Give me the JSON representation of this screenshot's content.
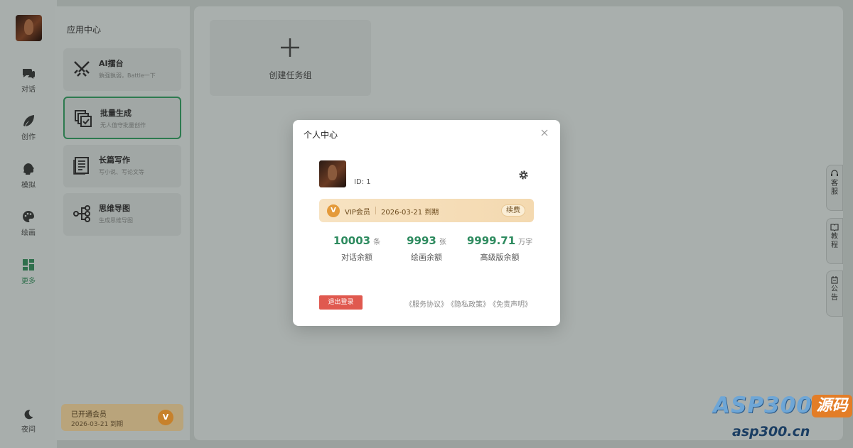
{
  "nav": {
    "items": [
      {
        "label": "对话",
        "icon": "chat-icon"
      },
      {
        "label": "创作",
        "icon": "feather-icon"
      },
      {
        "label": "模拟",
        "icon": "head-icon"
      },
      {
        "label": "绘画",
        "icon": "palette-icon"
      },
      {
        "label": "更多",
        "icon": "grid-icon"
      }
    ],
    "night_label": "夜间"
  },
  "panel": {
    "title": "应用中心",
    "apps": [
      {
        "title": "AI擂台",
        "subtitle": "孰强孰弱，Battle一下",
        "icon": "swords-icon"
      },
      {
        "title": "批量生成",
        "subtitle": "无人值守批量创作",
        "icon": "batch-icon"
      },
      {
        "title": "长篇写作",
        "subtitle": "写小说、写论文等",
        "icon": "document-icon"
      },
      {
        "title": "思维导图",
        "subtitle": "生成思维导图",
        "icon": "mindmap-icon"
      }
    ],
    "member": {
      "status": "已开通会员",
      "expiry": "2026-03-21 到期",
      "badge": "V"
    }
  },
  "main": {
    "create_label": "创建任务组"
  },
  "side_tabs": [
    {
      "label": "客服",
      "icon": "headset-icon"
    },
    {
      "label": "教程",
      "icon": "book-icon"
    },
    {
      "label": "公告",
      "icon": "notice-icon"
    }
  ],
  "modal": {
    "title": "个人中心",
    "user_id": "ID: 1",
    "vip": {
      "badge": "V",
      "label": "VIP会员",
      "expiry": "2026-03-21 到期",
      "renew": "续费"
    },
    "stats": [
      {
        "value": "10003",
        "unit": "条",
        "caption": "对话余额"
      },
      {
        "value": "9993",
        "unit": "张",
        "caption": "绘画余额"
      },
      {
        "value": "9999.71",
        "unit": "万字",
        "caption": "高级版余额"
      }
    ],
    "logout": "退出登录",
    "links": [
      "《服务协议》",
      "《隐私政策》",
      "《免责声明》"
    ]
  },
  "colors": {
    "accent": "#2e8b5f",
    "logout": "#e0594f",
    "vip_gold": "#e49a3a"
  },
  "watermark": {
    "brand": "ASP300",
    "badge": "源码",
    "url": "asp300.cn"
  }
}
